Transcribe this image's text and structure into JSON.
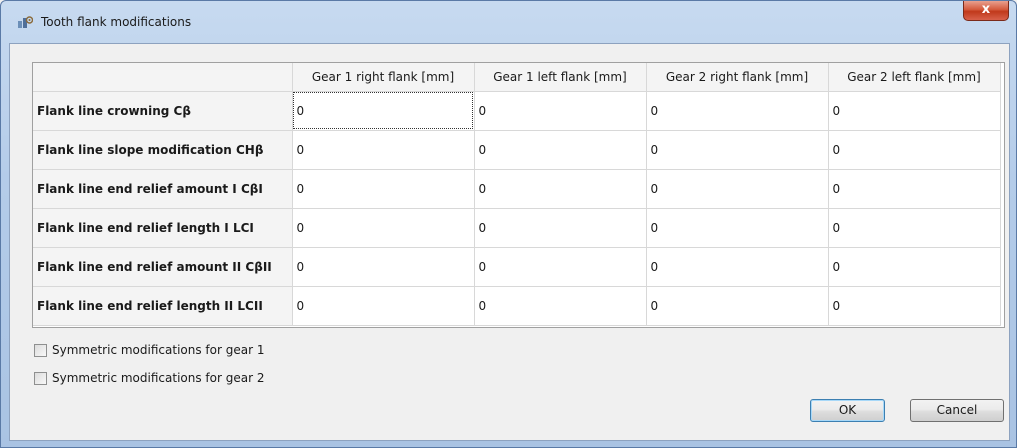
{
  "window": {
    "title": "Tooth flank modifications",
    "close_label": "x"
  },
  "table": {
    "columns": [
      "Gear 1 right flank [mm]",
      "Gear 1 left flank [mm]",
      "Gear 2 right flank [mm]",
      "Gear 2 left flank [mm]"
    ],
    "rows": [
      {
        "label": "Flank line crowning Cβ",
        "values": [
          "0",
          "0",
          "0",
          "0"
        ]
      },
      {
        "label": "Flank line slope modification CHβ",
        "values": [
          "0",
          "0",
          "0",
          "0"
        ]
      },
      {
        "label": "Flank line end relief amount I CβI",
        "values": [
          "0",
          "0",
          "0",
          "0"
        ]
      },
      {
        "label": "Flank line end relief length I LCI",
        "values": [
          "0",
          "0",
          "0",
          "0"
        ]
      },
      {
        "label": "Flank line end relief amount II CβII",
        "values": [
          "0",
          "0",
          "0",
          "0"
        ]
      },
      {
        "label": "Flank line end relief length II LCII",
        "values": [
          "0",
          "0",
          "0",
          "0"
        ]
      }
    ]
  },
  "options": {
    "symmetric_gear1": "Symmetric modifications for gear 1",
    "symmetric_gear2": "Symmetric modifications for gear 2"
  },
  "buttons": {
    "ok": "OK",
    "cancel": "Cancel"
  }
}
